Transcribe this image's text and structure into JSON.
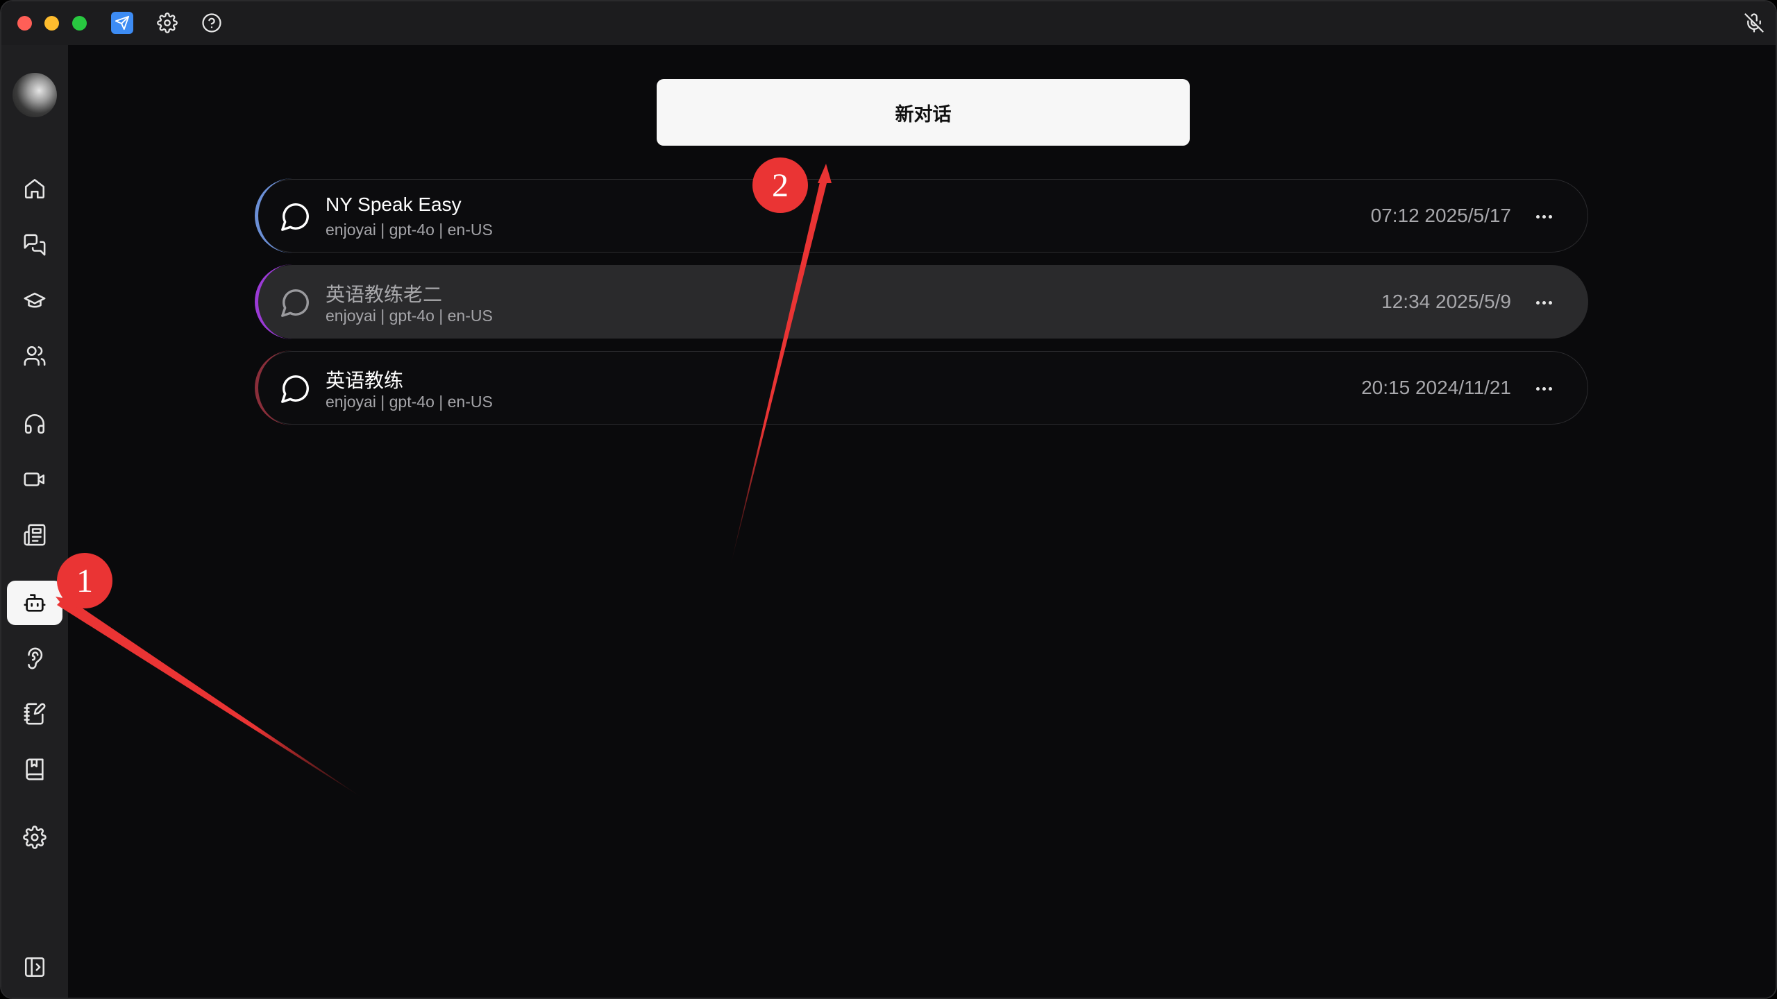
{
  "window": {
    "accent_color": "#3d8cf4",
    "titlebar_icons": [
      "app-logo-icon",
      "gear-icon",
      "help-circle-icon",
      "mic-off-icon"
    ]
  },
  "sidebar": {
    "items": [
      {
        "name": "home",
        "icon": "home-icon",
        "active": false
      },
      {
        "name": "chats",
        "icon": "chat-bubbles-icon",
        "active": false
      },
      {
        "name": "learning",
        "icon": "graduation-cap-icon",
        "active": false
      },
      {
        "name": "users",
        "icon": "users-icon",
        "active": false
      },
      {
        "name": "audio",
        "icon": "headphones-icon",
        "active": false
      },
      {
        "name": "video",
        "icon": "video-camera-icon",
        "active": false
      },
      {
        "name": "documents",
        "icon": "newspaper-icon",
        "active": false
      },
      {
        "name": "ai-conversations",
        "icon": "bot-icon",
        "active": true
      },
      {
        "name": "speech",
        "icon": "speech-icon",
        "active": false
      },
      {
        "name": "notes",
        "icon": "notebook-pen-icon",
        "active": false
      },
      {
        "name": "vocabulary",
        "icon": "book-bookmark-icon",
        "active": false
      },
      {
        "name": "settings",
        "icon": "gear-icon",
        "active": false
      },
      {
        "name": "expand-sidebar",
        "icon": "sidebar-expand-icon",
        "active": false
      }
    ]
  },
  "main": {
    "new_chat_label": "新对话",
    "conversations": [
      {
        "title": "NY Speak Easy",
        "subtitle": "enjoyai | gpt-4o | en-US",
        "time": "07:12 2025/5/17",
        "accent": "#6b8fd6",
        "selected": false
      },
      {
        "title": "英语教练老二",
        "subtitle": "enjoyai | gpt-4o | en-US",
        "time": "12:34 2025/5/9",
        "accent": "#9b3ad6",
        "selected": true
      },
      {
        "title": "英语教练",
        "subtitle": "enjoyai | gpt-4o | en-US",
        "time": "20:15 2024/11/21",
        "accent": "#8a2e3a",
        "selected": false
      }
    ]
  },
  "annotations": {
    "badge_1": "1",
    "badge_2": "2",
    "color": "#ea3434"
  }
}
